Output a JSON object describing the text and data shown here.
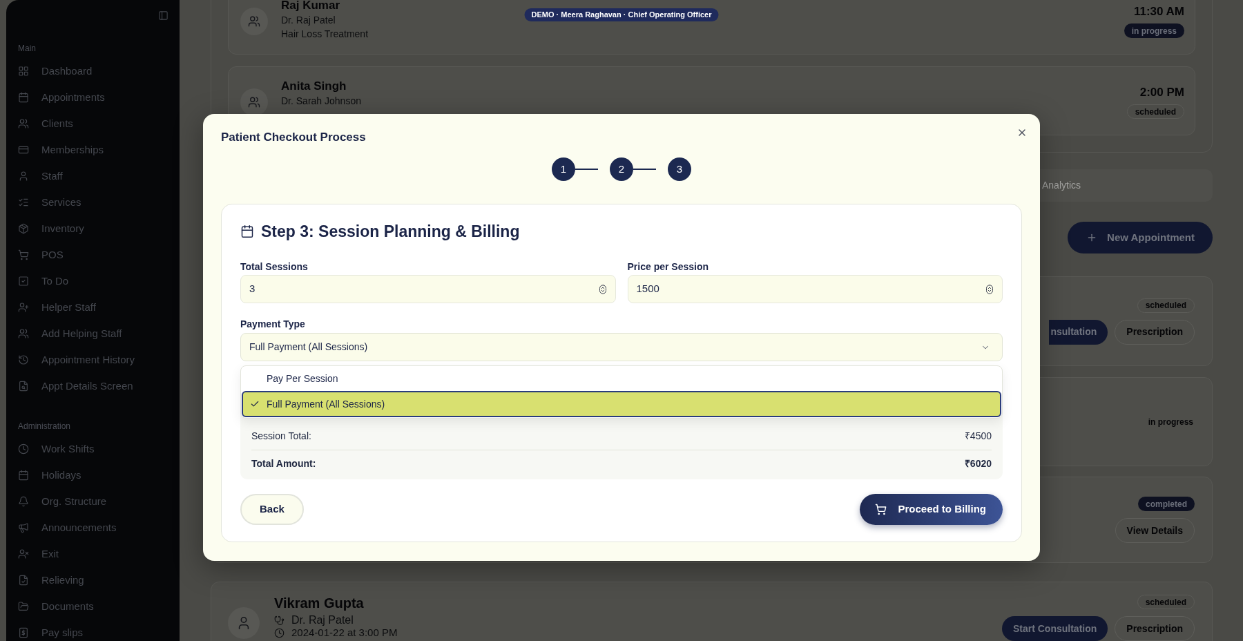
{
  "demo_banner": "DEMO · Meera Raghavan · Chief Operating Officer",
  "sidebar": {
    "sections": [
      {
        "title": "Main",
        "items": [
          {
            "label": "Dashboard"
          },
          {
            "label": "Appointments"
          },
          {
            "label": "Clients"
          },
          {
            "label": "Memberships"
          },
          {
            "label": "Staff"
          },
          {
            "label": "Services"
          },
          {
            "label": "Inventory"
          },
          {
            "label": "POS"
          },
          {
            "label": "To Do"
          },
          {
            "label": "Helper Staff"
          },
          {
            "label": "Add Helping Staff"
          },
          {
            "label": "Appointment History"
          },
          {
            "label": "Appt Details Screen"
          }
        ]
      },
      {
        "title": "Administration",
        "items": [
          {
            "label": "Work Shifts"
          },
          {
            "label": "Holidays"
          },
          {
            "label": "Org. Structure"
          },
          {
            "label": "Announcements"
          },
          {
            "label": "Exit"
          },
          {
            "label": "Relieving"
          },
          {
            "label": "Documents"
          },
          {
            "label": "Pay slips"
          }
        ]
      }
    ]
  },
  "today_appointments": [
    {
      "name": "Raj Kumar",
      "doctor": "Dr. Raj Patel",
      "service": "Hair Loss Treatment",
      "time": "11:30 AM",
      "status": {
        "text": "in progress",
        "kind": "filled"
      }
    },
    {
      "name": "Anita Singh",
      "doctor": "Dr. Sarah Johnson",
      "time": "2:00 PM",
      "status": {
        "text": "scheduled",
        "kind": "outline"
      }
    }
  ],
  "tabs": [
    {
      "label": "Analytics",
      "selected": false
    }
  ],
  "new_appointment_button": "New Appointment",
  "appointments": [
    {
      "status": {
        "text": "scheduled",
        "kind": "outline"
      },
      "actions": [
        {
          "label": "nsultation",
          "kind": "primary",
          "cut_off": true
        },
        {
          "label": "Prescription",
          "kind": "outline"
        }
      ]
    },
    {
      "status": {
        "text": "in progress",
        "kind": "plain"
      }
    },
    {
      "status": {
        "text": "completed",
        "kind": "filled"
      },
      "actions": [
        {
          "label": "View Details",
          "kind": "outline"
        }
      ]
    },
    {
      "name": "Vikram Gupta",
      "doctor": "Dr. Raj Patel",
      "datetime": "2024-01-22 at 3:00 PM",
      "status": {
        "text": "scheduled",
        "kind": "outline"
      },
      "actions": [
        {
          "label": "Start Consultation",
          "kind": "primary"
        },
        {
          "label": "Prescription",
          "kind": "outline"
        }
      ]
    }
  ],
  "modal": {
    "title": "Patient Checkout Process",
    "steps": [
      {
        "label": "1"
      },
      {
        "label": "2"
      },
      {
        "label": "3"
      }
    ],
    "section_title": "Step 3: Session Planning & Billing",
    "fields": [
      {
        "label": "Total Sessions",
        "value": "3"
      },
      {
        "label": "Price per Session",
        "value": "1500"
      }
    ],
    "payment_type": {
      "label": "Payment Type",
      "value": "Full Payment (All Sessions)",
      "expanded": true,
      "options": [
        {
          "label": "Pay Per Session",
          "selected": false
        },
        {
          "label": "Full Payment (All Sessions)",
          "selected": true
        }
      ]
    },
    "summary": [
      {
        "label": "Session Total:",
        "value": "₹4500",
        "kind": "subtotal"
      },
      {
        "label": "Total Amount:",
        "value": "₹6020",
        "kind": "total"
      }
    ],
    "back_button": "Back",
    "proceed_button": "Proceed to Billing"
  }
}
